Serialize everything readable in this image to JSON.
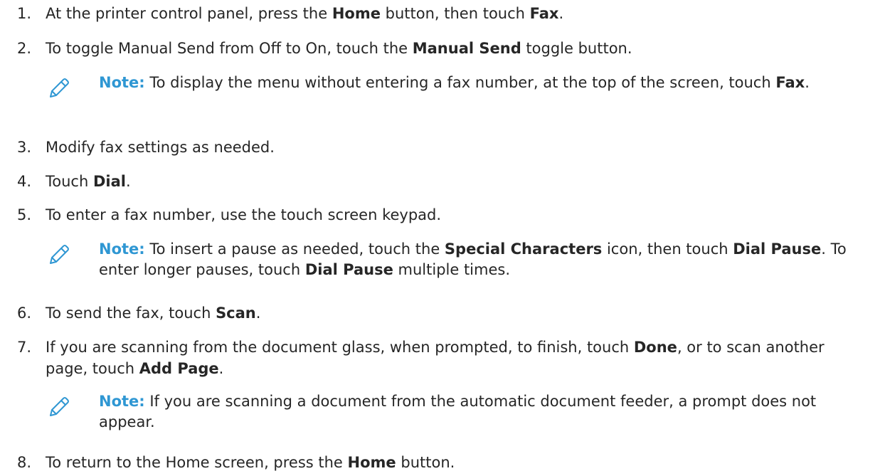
{
  "steps": [
    {
      "num": "1.",
      "parts": [
        "At the printer control panel, press the ",
        "Home",
        " button, then touch ",
        "Fax",
        "."
      ]
    },
    {
      "num": "2.",
      "parts": [
        "To toggle Manual Send from Off to On, touch the ",
        "Manual Send",
        " toggle button."
      ]
    },
    {
      "num": "3.",
      "parts": [
        "Modify fax settings as needed."
      ]
    },
    {
      "num": "4.",
      "parts": [
        "Touch ",
        "Dial",
        "."
      ]
    },
    {
      "num": "5.",
      "parts": [
        "To enter a fax number, use the touch screen keypad."
      ]
    },
    {
      "num": "6.",
      "parts": [
        "To send the fax, touch ",
        "Scan",
        "."
      ]
    },
    {
      "num": "7.",
      "parts": [
        "If you are scanning from the document glass, when prompted, to finish, touch ",
        "Done",
        ", or to scan another page, touch ",
        "Add Page",
        "."
      ]
    },
    {
      "num": "8.",
      "parts": [
        "To return to the Home screen, press the ",
        "Home",
        " button."
      ]
    }
  ],
  "notes": [
    {
      "label": "Note:",
      "parts": [
        " To display the menu without entering a fax number, at the top of the screen, touch ",
        "Fax",
        "."
      ]
    },
    {
      "label": "Note:",
      "parts": [
        " To insert a pause as needed, touch the ",
        "Special Characters",
        " icon, then touch ",
        "Dial Pause",
        ". To enter longer pauses, touch ",
        "Dial Pause",
        " multiple times."
      ]
    },
    {
      "label": "Note:",
      "parts": [
        " If you are scanning a document from the automatic document feeder, a prompt does not appear."
      ]
    }
  ],
  "colors": {
    "text": "#262626",
    "note_label": "#2f97d3",
    "note_icon": "#2f97d3"
  },
  "icons": {
    "note": "pencil-icon"
  }
}
